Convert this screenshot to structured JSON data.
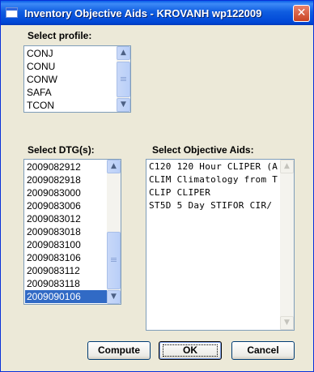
{
  "window": {
    "title": "Inventory Objective Aids  - KROVANH wp122009",
    "close_glyph": "✕"
  },
  "profile": {
    "label": "Select profile:",
    "items": [
      "CONJ",
      "CONU",
      "CONW",
      "SAFA",
      "TCON"
    ]
  },
  "dtg": {
    "label": "Select DTG(s):",
    "items": [
      "2009082912",
      "2009082918",
      "2009083000",
      "2009083006",
      "2009083012",
      "2009083018",
      "2009083100",
      "2009083106",
      "2009083112",
      "2009083118",
      "2009090106"
    ],
    "selected": "2009090106"
  },
  "aids": {
    "label": "Select Objective Aids:",
    "items": [
      "C120  120 Hour CLIPER (A",
      "CLIM  Climatology from T",
      "CLIP  CLIPER",
      "ST5D  5 Day STIFOR CIR/"
    ]
  },
  "buttons": {
    "compute": "Compute",
    "ok": "OK",
    "cancel": "Cancel"
  },
  "icons": {
    "scroll_up": "▲",
    "scroll_down": "▼"
  }
}
